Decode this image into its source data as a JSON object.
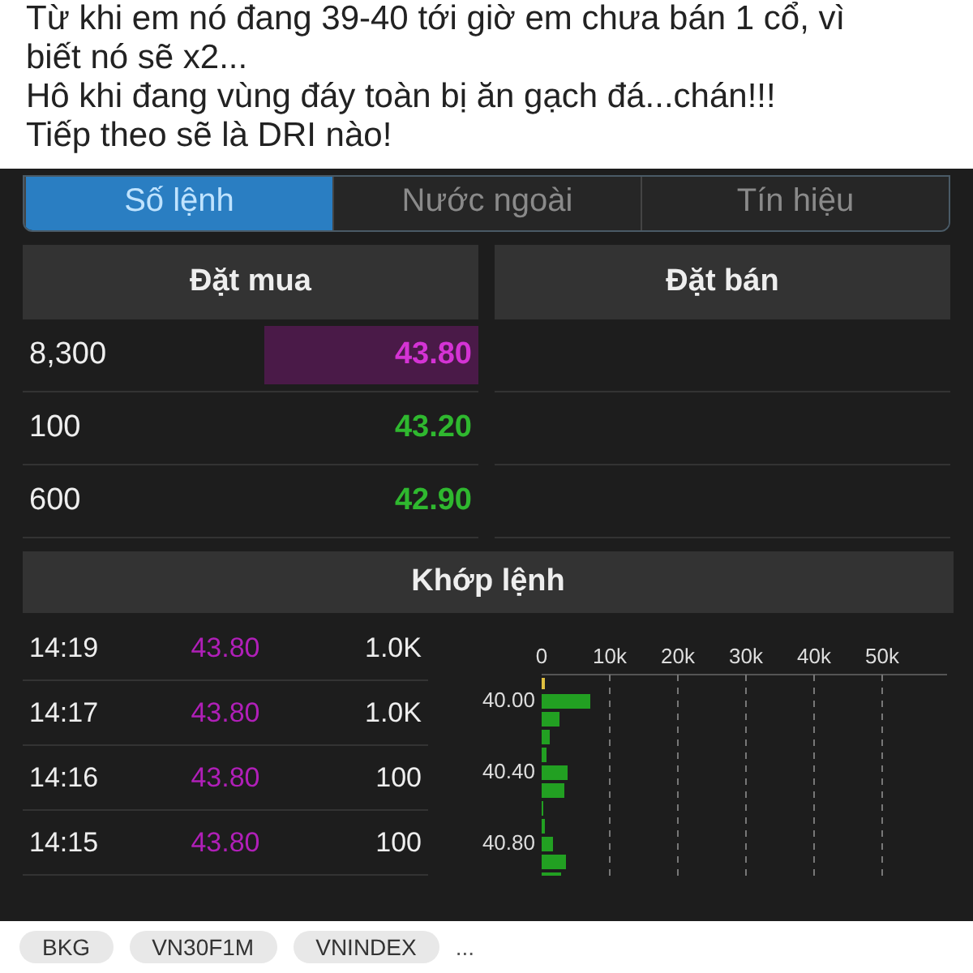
{
  "post": {
    "lines": [
      "Từ khi em nó đang 39-40 tới giờ em chưa bán 1 cổ, vì",
      "biết nó sẽ x2...",
      "Hô khi đang vùng đáy toàn bị ăn gạch đá...chán!!!",
      "Tiếp theo sẽ là DRI nào!"
    ]
  },
  "tabs": [
    {
      "label": "Số lệnh",
      "selected": true
    },
    {
      "label": "Nước ngoài",
      "selected": false
    },
    {
      "label": "Tín hiệu",
      "selected": false
    }
  ],
  "order_book": {
    "bid_header": "Đặt mua",
    "ask_header": "Đặt bán",
    "rows": [
      {
        "volume": "8,300",
        "price": "43.80",
        "color": "#d433d4",
        "highlighted": true
      },
      {
        "volume": "100",
        "price": "43.20",
        "color": "#2fb82f",
        "highlighted": false
      },
      {
        "volume": "600",
        "price": "42.90",
        "color": "#2fb82f",
        "highlighted": false
      }
    ]
  },
  "matched": {
    "header": "Khớp lệnh",
    "trades": [
      {
        "time": "14:19",
        "price": "43.80",
        "volume": "1.0K",
        "color": "#b01fb8"
      },
      {
        "time": "14:17",
        "price": "43.80",
        "volume": "1.0K",
        "color": "#b01fb8"
      },
      {
        "time": "14:16",
        "price": "43.80",
        "volume": "100",
        "color": "#b01fb8"
      },
      {
        "time": "14:15",
        "price": "43.80",
        "volume": "100",
        "color": "#b01fb8"
      }
    ],
    "chart": {
      "x_labels": [
        "0",
        "10k",
        "20k",
        "30k",
        "40k",
        "50k"
      ],
      "price_labels": [
        "40.00",
        "40.40",
        "40.80"
      ]
    }
  },
  "tags": [
    "BKG",
    "VN30F1M",
    "VNINDEX"
  ],
  "more": "..."
}
